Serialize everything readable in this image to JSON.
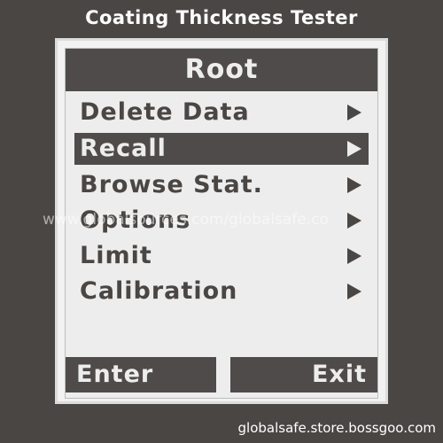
{
  "device": {
    "title": "Coating Thickness Tester"
  },
  "screen": {
    "header": "Root",
    "menu": [
      {
        "label": "Delete Data",
        "selected": false,
        "icon": "right-arrow-icon"
      },
      {
        "label": "Recall",
        "selected": true,
        "icon": "right-arrow-icon"
      },
      {
        "label": "Browse Stat.",
        "selected": false,
        "icon": "right-arrow-icon"
      },
      {
        "label": "Options",
        "selected": false,
        "icon": "right-arrow-icon"
      },
      {
        "label": "Limit",
        "selected": false,
        "icon": "right-arrow-icon"
      },
      {
        "label": "Calibration",
        "selected": false,
        "icon": "right-arrow-icon"
      }
    ],
    "softkeys": {
      "left": "Enter",
      "right": "Exit"
    }
  },
  "watermarks": {
    "middle": "www.globalsources.com/globalsafe.co",
    "bottom": "globalsafe.store.bossgoo.com"
  },
  "colors": {
    "bezel": "#4a4644",
    "screen": "#ededed",
    "highlight": "#4f4b4a"
  }
}
